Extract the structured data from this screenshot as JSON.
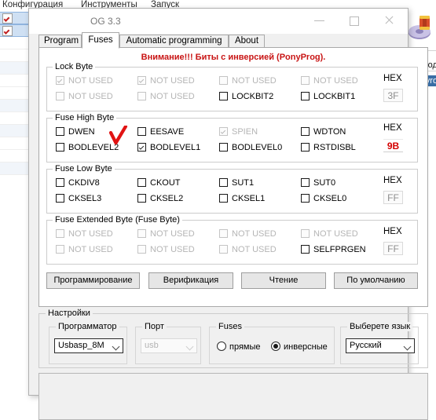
{
  "background": {
    "menu": [
      "Конфигурация",
      "Инструменты",
      "Запуск"
    ],
    "right_text_1": "свобод",
    "right_text_2": "ps\\avro",
    "icon_name": "spool-disc-icon"
  },
  "window": {
    "title": "OG 3.3",
    "controls": {
      "minimize": "minimize-button",
      "maximize": "maximize-button",
      "close": "close-button"
    }
  },
  "tabs": [
    {
      "label": "Program",
      "active": false
    },
    {
      "label": "Fuses",
      "active": true
    },
    {
      "label": "Automatic programming",
      "active": false
    },
    {
      "label": "About",
      "active": false
    }
  ],
  "warning": "Внимание!!! Биты с инверсией (PonyProg).",
  "groups": [
    {
      "title": "Lock Byte",
      "hex_label": "HEX",
      "hex_value": "3F",
      "hex_style": "gray",
      "bits": [
        {
          "label": "NOT USED",
          "checked": true,
          "disabled": true
        },
        {
          "label": "NOT USED",
          "checked": true,
          "disabled": true
        },
        {
          "label": "NOT USED",
          "checked": false,
          "disabled": true
        },
        {
          "label": "NOT USED",
          "checked": false,
          "disabled": true
        },
        {
          "label": "NOT USED",
          "checked": false,
          "disabled": true
        },
        {
          "label": "NOT USED",
          "checked": false,
          "disabled": true
        },
        {
          "label": "LOCKBIT2",
          "checked": false,
          "disabled": false
        },
        {
          "label": "LOCKBIT1",
          "checked": false,
          "disabled": false
        }
      ]
    },
    {
      "title": "Fuse High Byte",
      "hex_label": "HEX",
      "hex_value": "9B",
      "hex_style": "red",
      "bits": [
        {
          "label": "DWEN",
          "checked": false,
          "disabled": false
        },
        {
          "label": "EESAVE",
          "checked": false,
          "disabled": false
        },
        {
          "label": "SPIEN",
          "checked": true,
          "disabled": true
        },
        {
          "label": "WDTON",
          "checked": false,
          "disabled": false
        },
        {
          "label": "BODLEVEL2",
          "checked": false,
          "disabled": false
        },
        {
          "label": "BODLEVEL1",
          "checked": true,
          "disabled": false
        },
        {
          "label": "BODLEVEL0",
          "checked": false,
          "disabled": false
        },
        {
          "label": "RSTDISBL",
          "checked": false,
          "disabled": false
        }
      ]
    },
    {
      "title": "Fuse Low Byte",
      "hex_label": "HEX",
      "hex_value": "FF",
      "hex_style": "gray",
      "bits": [
        {
          "label": "CKDIV8",
          "checked": false,
          "disabled": false
        },
        {
          "label": "CKOUT",
          "checked": false,
          "disabled": false
        },
        {
          "label": "SUT1",
          "checked": false,
          "disabled": false
        },
        {
          "label": "SUT0",
          "checked": false,
          "disabled": false
        },
        {
          "label": "CKSEL3",
          "checked": false,
          "disabled": false
        },
        {
          "label": "CKSEL2",
          "checked": false,
          "disabled": false
        },
        {
          "label": "CKSEL1",
          "checked": false,
          "disabled": false
        },
        {
          "label": "CKSEL0",
          "checked": false,
          "disabled": false
        }
      ]
    },
    {
      "title": "Fuse Extended Byte (Fuse Byte)",
      "hex_label": "HEX",
      "hex_value": "FF",
      "hex_style": "gray",
      "bits": [
        {
          "label": "NOT USED",
          "checked": false,
          "disabled": true
        },
        {
          "label": "NOT USED",
          "checked": false,
          "disabled": true
        },
        {
          "label": "NOT USED",
          "checked": false,
          "disabled": true
        },
        {
          "label": "NOT USED",
          "checked": false,
          "disabled": true
        },
        {
          "label": "NOT USED",
          "checked": false,
          "disabled": true
        },
        {
          "label": "NOT USED",
          "checked": false,
          "disabled": true
        },
        {
          "label": "NOT USED",
          "checked": false,
          "disabled": true
        },
        {
          "label": "SELFPRGEN",
          "checked": false,
          "disabled": false
        }
      ]
    }
  ],
  "annotation": {
    "name": "red-check-mark",
    "color": "#e11313",
    "over": "EESAVE"
  },
  "actions": [
    {
      "label": "Программирование"
    },
    {
      "label": "Верификация"
    },
    {
      "label": "Чтение"
    },
    {
      "label": "По умолчанию"
    }
  ],
  "settings": {
    "title": "Настройки",
    "programmer": {
      "label": "Программатор",
      "value": "Usbasp_8M",
      "disabled": false
    },
    "port": {
      "label": "Порт",
      "value": "usb",
      "disabled": true
    },
    "fuses": {
      "label": "Fuses",
      "options": [
        {
          "label": "прямые",
          "selected": false
        },
        {
          "label": "инверсные",
          "selected": true
        }
      ]
    },
    "language": {
      "label": "Выберете язык",
      "value": "Русский",
      "disabled": false
    }
  }
}
